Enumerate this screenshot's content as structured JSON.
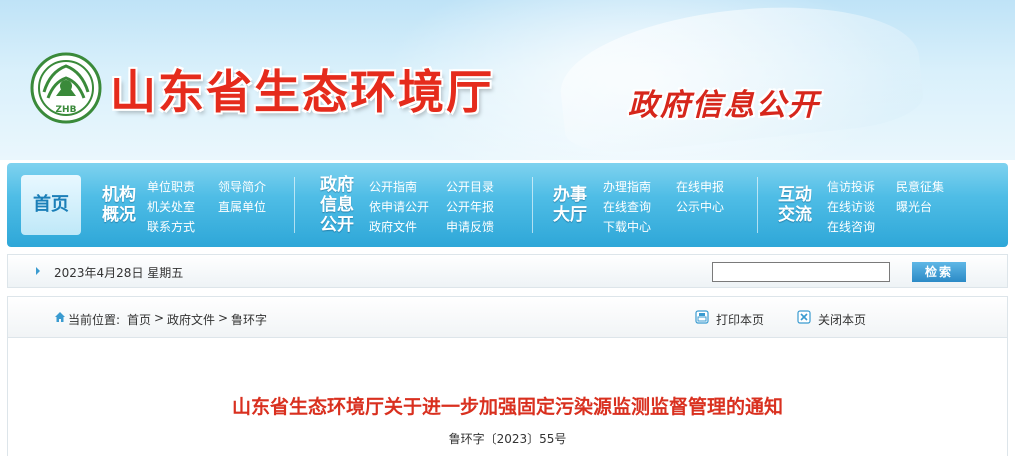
{
  "header": {
    "site_title": "山东省生态环境厅",
    "section_title": "政府信息公开",
    "logo_icon": "zhb-emblem-icon",
    "logo_text": "ZHB"
  },
  "nav": {
    "home": "首页",
    "groups": [
      {
        "title_lines": [
          "机构",
          "概况"
        ],
        "links": [
          "单位职责",
          "领导简介",
          "机关处室",
          "直属单位",
          "联系方式"
        ]
      },
      {
        "title_lines": [
          "政府",
          "信息",
          "公开"
        ],
        "links": [
          "公开指南",
          "公开目录",
          "依申请公开",
          "公开年报",
          "政府文件",
          "申请反馈"
        ]
      },
      {
        "title_lines": [
          "办事",
          "大厅"
        ],
        "links": [
          "办理指南",
          "在线申报",
          "在线查询",
          "公示中心",
          "下载中心"
        ]
      },
      {
        "title_lines": [
          "互动",
          "交流"
        ],
        "links": [
          "信访投诉",
          "民意征集",
          "在线访谈",
          "曝光台",
          "在线咨询"
        ]
      }
    ]
  },
  "datebar": {
    "date": "2023年4月28日 星期五",
    "search_value": "",
    "search_button": "检索"
  },
  "breadcrumb": {
    "prefix": "当前位置:",
    "items": [
      "首页",
      "政府文件",
      "鲁环字"
    ],
    "separator": ">",
    "print": "打印本页",
    "close": "关闭本页"
  },
  "document": {
    "title": "山东省生态环境厅关于进一步加强固定污染源监测监督管理的通知",
    "number": "鲁环字〔2023〕55号"
  },
  "colors": {
    "title_red": "#e52b1c",
    "nav_blue": "#2ea7d8",
    "doc_title_red": "#d9301f"
  }
}
